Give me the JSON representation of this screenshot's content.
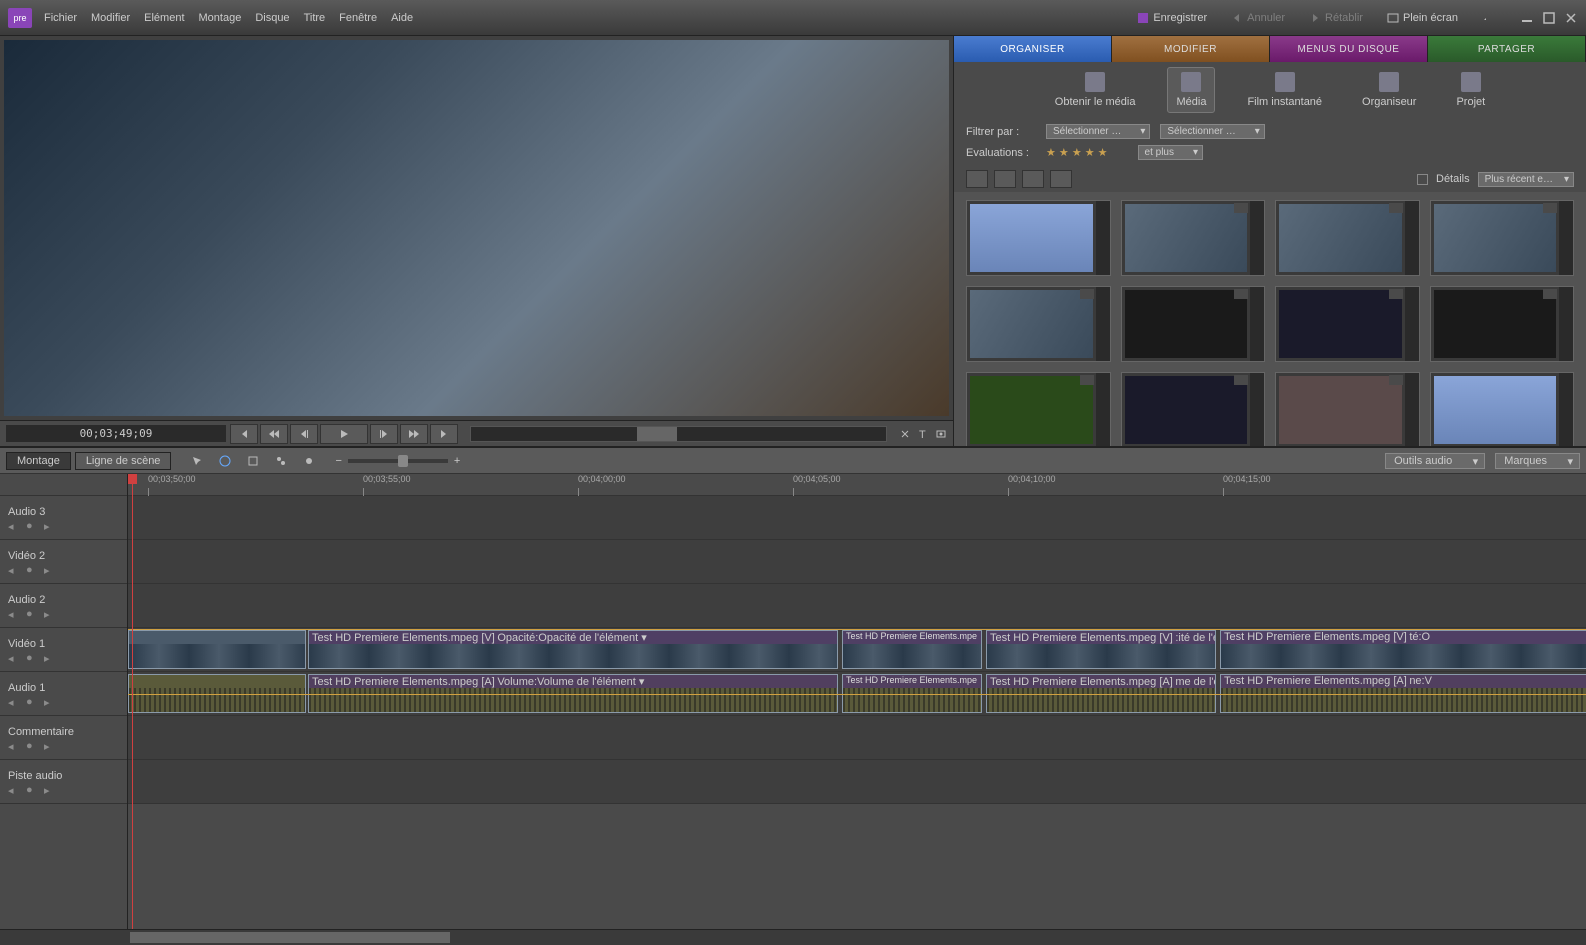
{
  "titlebar": {
    "logo": "pre",
    "menu": [
      "Fichier",
      "Modifier",
      "Elément",
      "Montage",
      "Disque",
      "Titre",
      "Fenêtre",
      "Aide"
    ],
    "save": "Enregistrer",
    "undo": "Annuler",
    "redo": "Rétablir",
    "fullscreen": "Plein écran"
  },
  "preview": {
    "timecode": "00;03;49;09"
  },
  "org": {
    "tabs": {
      "organiser": "ORGANISER",
      "modifier": "MODIFIER",
      "menus": "MENUS DU DISQUE",
      "partager": "PARTAGER"
    },
    "tools": {
      "obtenir": "Obtenir le média",
      "media": "Média",
      "instant": "Film instantané",
      "organiseur": "Organiseur",
      "projet": "Projet"
    },
    "filter_label": "Filtrer par :",
    "filter_sel": "Sélectionner …",
    "eval_label": "Evaluations :",
    "etplus": "et plus",
    "details": "Détails",
    "sort": "Plus récent e…"
  },
  "timeline": {
    "tab_montage": "Montage",
    "tab_scene": "Ligne de scène",
    "dd_audio": "Outils audio",
    "dd_marques": "Marques",
    "ruler": [
      "00;03;50;00",
      "00;03;55;00",
      "00;04;00;00",
      "00;04;05;00",
      "00;04;10;00",
      "00;04;15;00"
    ],
    "tracks": [
      "Audio 3",
      "Vidéo 2",
      "Audio 2",
      "Vidéo 1",
      "Audio 1",
      "Commentaire",
      "Piste audio"
    ],
    "clip_v1_a": "Test HD Premiere Elements.mpeg [V]",
    "clip_v1_a_fx": "Opacité:Opacité de l'élément ▾",
    "clip_a1_a": "Test HD Premiere Elements.mpeg [A]",
    "clip_a1_a_fx": "Volume:Volume de l'élément ▾",
    "clip_v1_b": "Test HD Premiere Elements.mpe",
    "clip_v1_c": "Test HD Premiere Elements.mpeg [V]",
    "clip_v1_c_fx": ":ité de l'élément ▾",
    "clip_v1_d": "Test HD Premiere Elements.mpeg [V]",
    "clip_v1_d_fx": "té:O",
    "clip_a1_b": "Test HD Premiere Elements.mpe",
    "clip_a1_c": "Test HD Premiere Elements.mpeg [A]",
    "clip_a1_c_fx": "me de l'élément ▾",
    "clip_a1_d": "Test HD Premiere Elements.mpeg [A]",
    "clip_a1_d_fx": "ne:V"
  }
}
